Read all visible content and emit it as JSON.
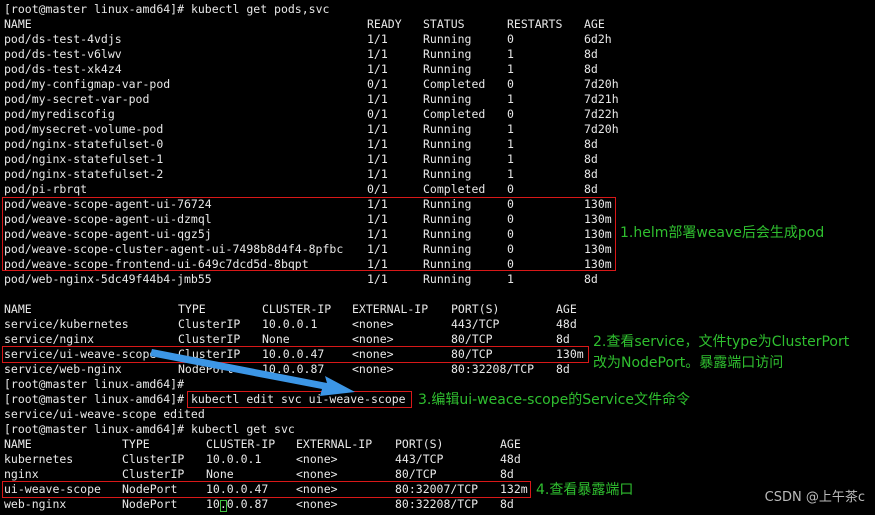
{
  "terminal": {
    "prompt": "[root@master linux-amd64]#",
    "commands": {
      "get_pods_svc": "kubectl get pods,svc",
      "edit_svc": "kubectl edit svc ui-weave-scope",
      "get_svc": "kubectl get svc"
    },
    "edit_result": "service/ui-weave-scope edited"
  },
  "pods": {
    "headers": [
      "NAME",
      "READY",
      "STATUS",
      "RESTARTS",
      "AGE"
    ],
    "rows": [
      [
        "pod/ds-test-4vdjs",
        "1/1",
        "Running",
        "0",
        "6d2h"
      ],
      [
        "pod/ds-test-v6lwv",
        "1/1",
        "Running",
        "1",
        "8d"
      ],
      [
        "pod/ds-test-xk4z4",
        "1/1",
        "Running",
        "1",
        "8d"
      ],
      [
        "pod/my-configmap-var-pod",
        "0/1",
        "Completed",
        "0",
        "7d20h"
      ],
      [
        "pod/my-secret-var-pod",
        "1/1",
        "Running",
        "1",
        "7d21h"
      ],
      [
        "pod/myrediscofig",
        "0/1",
        "Completed",
        "0",
        "7d22h"
      ],
      [
        "pod/mysecret-volume-pod",
        "1/1",
        "Running",
        "1",
        "7d20h"
      ],
      [
        "pod/nginx-statefulset-0",
        "1/1",
        "Running",
        "1",
        "8d"
      ],
      [
        "pod/nginx-statefulset-1",
        "1/1",
        "Running",
        "1",
        "8d"
      ],
      [
        "pod/nginx-statefulset-2",
        "1/1",
        "Running",
        "1",
        "8d"
      ],
      [
        "pod/pi-rbrqt",
        "0/1",
        "Completed",
        "0",
        "8d"
      ],
      [
        "pod/weave-scope-agent-ui-76724",
        "1/1",
        "Running",
        "0",
        "130m"
      ],
      [
        "pod/weave-scope-agent-ui-dzmql",
        "1/1",
        "Running",
        "0",
        "130m"
      ],
      [
        "pod/weave-scope-agent-ui-qgz5j",
        "1/1",
        "Running",
        "0",
        "130m"
      ],
      [
        "pod/weave-scope-cluster-agent-ui-7498b8d4f4-8pfbc",
        "1/1",
        "Running",
        "0",
        "130m"
      ],
      [
        "pod/weave-scope-frontend-ui-649c7dcd5d-8bqpt",
        "1/1",
        "Running",
        "0",
        "130m"
      ],
      [
        "pod/web-nginx-5dc49f44b4-jmb55",
        "1/1",
        "Running",
        "1",
        "8d"
      ]
    ]
  },
  "services1": {
    "headers": [
      "NAME",
      "TYPE",
      "CLUSTER-IP",
      "EXTERNAL-IP",
      "PORT(S)",
      "AGE"
    ],
    "rows": [
      [
        "service/kubernetes",
        "ClusterIP",
        "10.0.0.1",
        "<none>",
        "443/TCP",
        "48d"
      ],
      [
        "service/nginx",
        "ClusterIP",
        "None",
        "<none>",
        "80/TCP",
        "8d"
      ],
      [
        "service/ui-weave-scope",
        "ClusterIP",
        "10.0.0.47",
        "<none>",
        "80/TCP",
        "130m"
      ],
      [
        "service/web-nginx",
        "NodePort",
        "10.0.0.87",
        "<none>",
        "80:32208/TCP",
        "8d"
      ]
    ]
  },
  "services2": {
    "headers": [
      "NAME",
      "TYPE",
      "CLUSTER-IP",
      "EXTERNAL-IP",
      "PORT(S)",
      "AGE"
    ],
    "rows": [
      [
        "kubernetes",
        "ClusterIP",
        "10.0.0.1",
        "<none>",
        "443/TCP",
        "48d"
      ],
      [
        "nginx",
        "ClusterIP",
        "None",
        "<none>",
        "80/TCP",
        "8d"
      ],
      [
        "ui-weave-scope",
        "NodePort",
        "10.0.0.47",
        "<none>",
        "80:32007/TCP",
        "132m"
      ],
      [
        "web-nginx",
        "NodePort",
        "10.0.0.87",
        "<none>",
        "80:32208/TCP",
        "8d"
      ]
    ]
  },
  "annotations": {
    "note1": "1.helm部署weave后会生成pod",
    "note2_line1": "2.查看service，文件type为ClusterPort",
    "note2_line2": "改为NodePort。暴露端口访问",
    "note3": "3.编辑ui-weace-scope的Service文件命令",
    "note4": "4.查看暴露端口"
  },
  "watermark": "CSDN @上午茶c",
  "colors": {
    "background": "#000000",
    "text": "#e8e8e8",
    "highlight_box": "#d81818",
    "annotation": "#2fbf2f",
    "arrow": "#3c96e6"
  }
}
